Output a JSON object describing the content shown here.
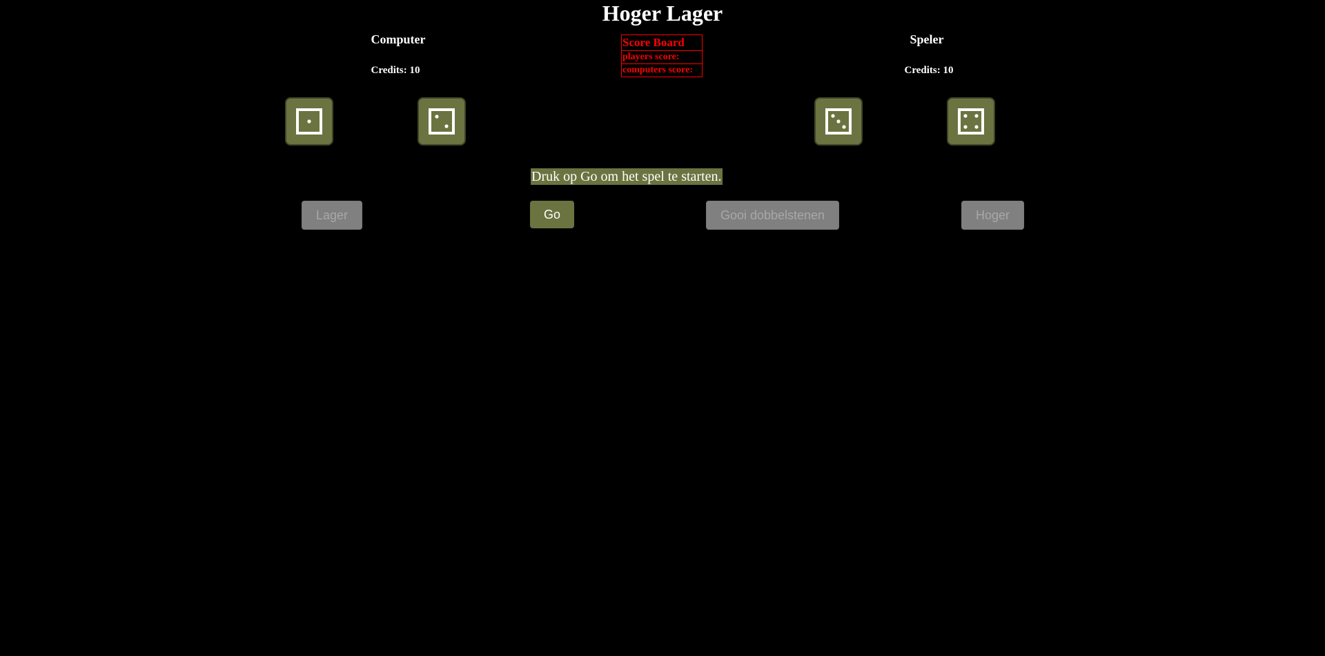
{
  "title": "Hoger Lager",
  "computer": {
    "name": "Computer",
    "credits": "Credits: 10",
    "dice": [
      1,
      2
    ]
  },
  "player": {
    "name": "Speler",
    "credits": "Credits: 10",
    "dice": [
      3,
      4
    ]
  },
  "scoreboard": {
    "heading": "Score Board",
    "players_score": "players score:",
    "computers_score": "computers score:"
  },
  "message": "Druk op Go om het spel te starten.",
  "buttons": {
    "lager": "Lager",
    "go": "Go",
    "gooi": "Gooi dobbelstenen",
    "hoger": "Hoger"
  },
  "colors": {
    "background": "#000000",
    "accent": "#6b7340",
    "scoreboard": "#ff0000",
    "disabled_button": "#808080"
  }
}
